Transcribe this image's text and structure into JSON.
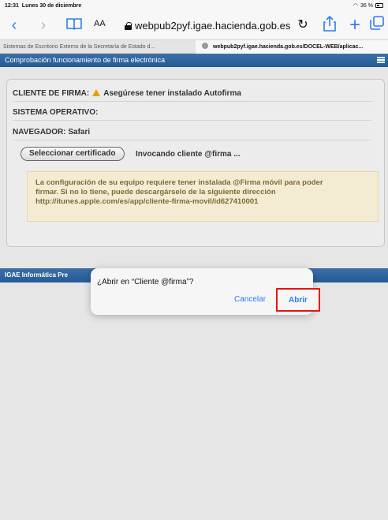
{
  "status_bar": {
    "time": "12:31",
    "date": "Lunes 30 de diciembre",
    "battery": "36 %"
  },
  "toolbar": {
    "text_size_label": "AA",
    "url": "webpub2pyf.igae.hacienda.gob.es"
  },
  "tabs": [
    {
      "label": "Sistemas de Escritorio Externo de la Secretaría de Estado d..."
    },
    {
      "label": "webpub2pyf.igae.hacienda.gob.es/DOCEL-WEB/aplicac..."
    }
  ],
  "page": {
    "header_title": "Comprobación funcionamiento de firma electrónica",
    "client_label": "CLIENTE DE FIRMA:",
    "client_value": "Asegúrese tener instalado Autofirma",
    "os_label": "SISTEMA OPERATIVO:",
    "browser_label": "NAVEGADOR: Safari",
    "select_button": "Seleccionar certificado",
    "invoking_text": "Invocando cliente @firma ...",
    "info_line1": "La configuración de su equipo requiere tener instalada @Firma móvil para poder",
    "info_line2": "firmar. Si no lo tiene, puede descargárselo de la siguiente dirección",
    "info_link": "http://itunes.apple.com/es/app/cliente-firma-movil/id627410001",
    "footer_text": "IGAE Informática Pre"
  },
  "dialog": {
    "title": "¿Abrir en “Cliente @firma”?",
    "cancel": "Cancelar",
    "open": "Abrir"
  },
  "colors": {
    "accent": "#2e7cf6",
    "header": "#245a96",
    "highlight": "#e11111"
  }
}
